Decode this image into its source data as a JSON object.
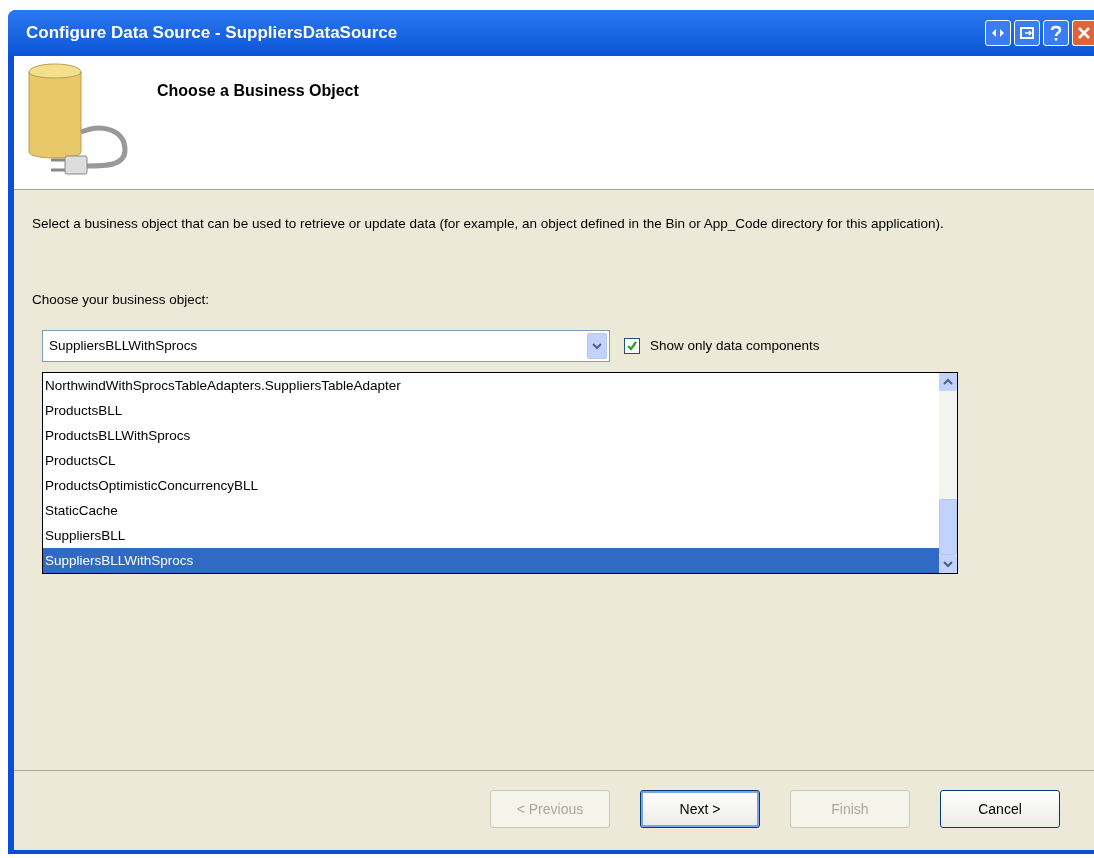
{
  "window": {
    "title": "Configure Data Source - SuppliersDataSource"
  },
  "header": {
    "title": "Choose a Business Object"
  },
  "description": "Select a business object that can be used to retrieve or update data (for example, an object defined in the Bin or App_Code directory for this application).",
  "business_object": {
    "label": "Choose your business object:",
    "value": "SuppliersBLLWithSprocs"
  },
  "show_only_data_components": {
    "label": "Show only data components",
    "checked": true
  },
  "list_items": [
    {
      "label": "NorthwindWithSprocsTableAdapters.SuppliersTableAdapter",
      "selected": false
    },
    {
      "label": "ProductsBLL",
      "selected": false
    },
    {
      "label": "ProductsBLLWithSprocs",
      "selected": false
    },
    {
      "label": "ProductsCL",
      "selected": false
    },
    {
      "label": "ProductsOptimisticConcurrencyBLL",
      "selected": false
    },
    {
      "label": "StaticCache",
      "selected": false
    },
    {
      "label": "SuppliersBLL",
      "selected": false
    },
    {
      "label": "SuppliersBLLWithSprocs",
      "selected": true
    }
  ],
  "buttons": [
    {
      "label": "< Previous",
      "disabled": true,
      "default": false
    },
    {
      "label": "Next >",
      "disabled": false,
      "default": true
    },
    {
      "label": "Finish",
      "disabled": true,
      "default": false
    },
    {
      "label": "Cancel",
      "disabled": false,
      "default": false
    }
  ]
}
